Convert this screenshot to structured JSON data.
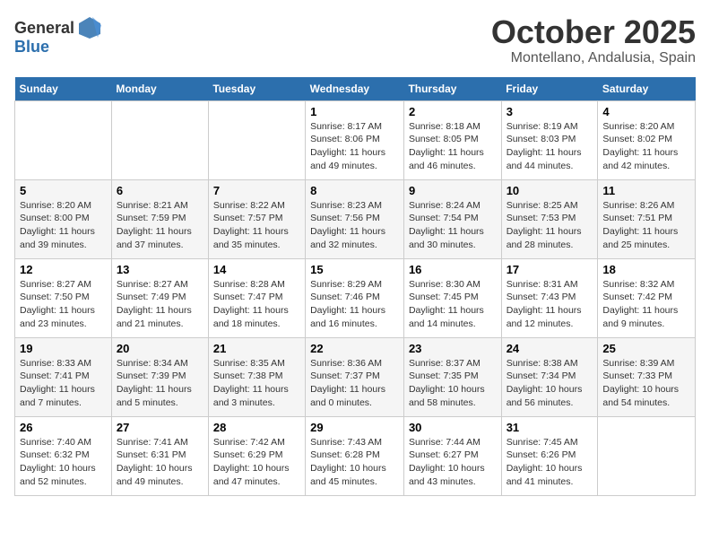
{
  "header": {
    "logo_general": "General",
    "logo_blue": "Blue",
    "month_title": "October 2025",
    "location": "Montellano, Andalusia, Spain"
  },
  "weekdays": [
    "Sunday",
    "Monday",
    "Tuesday",
    "Wednesday",
    "Thursday",
    "Friday",
    "Saturday"
  ],
  "weeks": [
    [
      {
        "day": "",
        "info": ""
      },
      {
        "day": "",
        "info": ""
      },
      {
        "day": "",
        "info": ""
      },
      {
        "day": "1",
        "info": "Sunrise: 8:17 AM\nSunset: 8:06 PM\nDaylight: 11 hours\nand 49 minutes."
      },
      {
        "day": "2",
        "info": "Sunrise: 8:18 AM\nSunset: 8:05 PM\nDaylight: 11 hours\nand 46 minutes."
      },
      {
        "day": "3",
        "info": "Sunrise: 8:19 AM\nSunset: 8:03 PM\nDaylight: 11 hours\nand 44 minutes."
      },
      {
        "day": "4",
        "info": "Sunrise: 8:20 AM\nSunset: 8:02 PM\nDaylight: 11 hours\nand 42 minutes."
      }
    ],
    [
      {
        "day": "5",
        "info": "Sunrise: 8:20 AM\nSunset: 8:00 PM\nDaylight: 11 hours\nand 39 minutes."
      },
      {
        "day": "6",
        "info": "Sunrise: 8:21 AM\nSunset: 7:59 PM\nDaylight: 11 hours\nand 37 minutes."
      },
      {
        "day": "7",
        "info": "Sunrise: 8:22 AM\nSunset: 7:57 PM\nDaylight: 11 hours\nand 35 minutes."
      },
      {
        "day": "8",
        "info": "Sunrise: 8:23 AM\nSunset: 7:56 PM\nDaylight: 11 hours\nand 32 minutes."
      },
      {
        "day": "9",
        "info": "Sunrise: 8:24 AM\nSunset: 7:54 PM\nDaylight: 11 hours\nand 30 minutes."
      },
      {
        "day": "10",
        "info": "Sunrise: 8:25 AM\nSunset: 7:53 PM\nDaylight: 11 hours\nand 28 minutes."
      },
      {
        "day": "11",
        "info": "Sunrise: 8:26 AM\nSunset: 7:51 PM\nDaylight: 11 hours\nand 25 minutes."
      }
    ],
    [
      {
        "day": "12",
        "info": "Sunrise: 8:27 AM\nSunset: 7:50 PM\nDaylight: 11 hours\nand 23 minutes."
      },
      {
        "day": "13",
        "info": "Sunrise: 8:27 AM\nSunset: 7:49 PM\nDaylight: 11 hours\nand 21 minutes."
      },
      {
        "day": "14",
        "info": "Sunrise: 8:28 AM\nSunset: 7:47 PM\nDaylight: 11 hours\nand 18 minutes."
      },
      {
        "day": "15",
        "info": "Sunrise: 8:29 AM\nSunset: 7:46 PM\nDaylight: 11 hours\nand 16 minutes."
      },
      {
        "day": "16",
        "info": "Sunrise: 8:30 AM\nSunset: 7:45 PM\nDaylight: 11 hours\nand 14 minutes."
      },
      {
        "day": "17",
        "info": "Sunrise: 8:31 AM\nSunset: 7:43 PM\nDaylight: 11 hours\nand 12 minutes."
      },
      {
        "day": "18",
        "info": "Sunrise: 8:32 AM\nSunset: 7:42 PM\nDaylight: 11 hours\nand 9 minutes."
      }
    ],
    [
      {
        "day": "19",
        "info": "Sunrise: 8:33 AM\nSunset: 7:41 PM\nDaylight: 11 hours\nand 7 minutes."
      },
      {
        "day": "20",
        "info": "Sunrise: 8:34 AM\nSunset: 7:39 PM\nDaylight: 11 hours\nand 5 minutes."
      },
      {
        "day": "21",
        "info": "Sunrise: 8:35 AM\nSunset: 7:38 PM\nDaylight: 11 hours\nand 3 minutes."
      },
      {
        "day": "22",
        "info": "Sunrise: 8:36 AM\nSunset: 7:37 PM\nDaylight: 11 hours\nand 0 minutes."
      },
      {
        "day": "23",
        "info": "Sunrise: 8:37 AM\nSunset: 7:35 PM\nDaylight: 10 hours\nand 58 minutes."
      },
      {
        "day": "24",
        "info": "Sunrise: 8:38 AM\nSunset: 7:34 PM\nDaylight: 10 hours\nand 56 minutes."
      },
      {
        "day": "25",
        "info": "Sunrise: 8:39 AM\nSunset: 7:33 PM\nDaylight: 10 hours\nand 54 minutes."
      }
    ],
    [
      {
        "day": "26",
        "info": "Sunrise: 7:40 AM\nSunset: 6:32 PM\nDaylight: 10 hours\nand 52 minutes."
      },
      {
        "day": "27",
        "info": "Sunrise: 7:41 AM\nSunset: 6:31 PM\nDaylight: 10 hours\nand 49 minutes."
      },
      {
        "day": "28",
        "info": "Sunrise: 7:42 AM\nSunset: 6:29 PM\nDaylight: 10 hours\nand 47 minutes."
      },
      {
        "day": "29",
        "info": "Sunrise: 7:43 AM\nSunset: 6:28 PM\nDaylight: 10 hours\nand 45 minutes."
      },
      {
        "day": "30",
        "info": "Sunrise: 7:44 AM\nSunset: 6:27 PM\nDaylight: 10 hours\nand 43 minutes."
      },
      {
        "day": "31",
        "info": "Sunrise: 7:45 AM\nSunset: 6:26 PM\nDaylight: 10 hours\nand 41 minutes."
      },
      {
        "day": "",
        "info": ""
      }
    ]
  ]
}
